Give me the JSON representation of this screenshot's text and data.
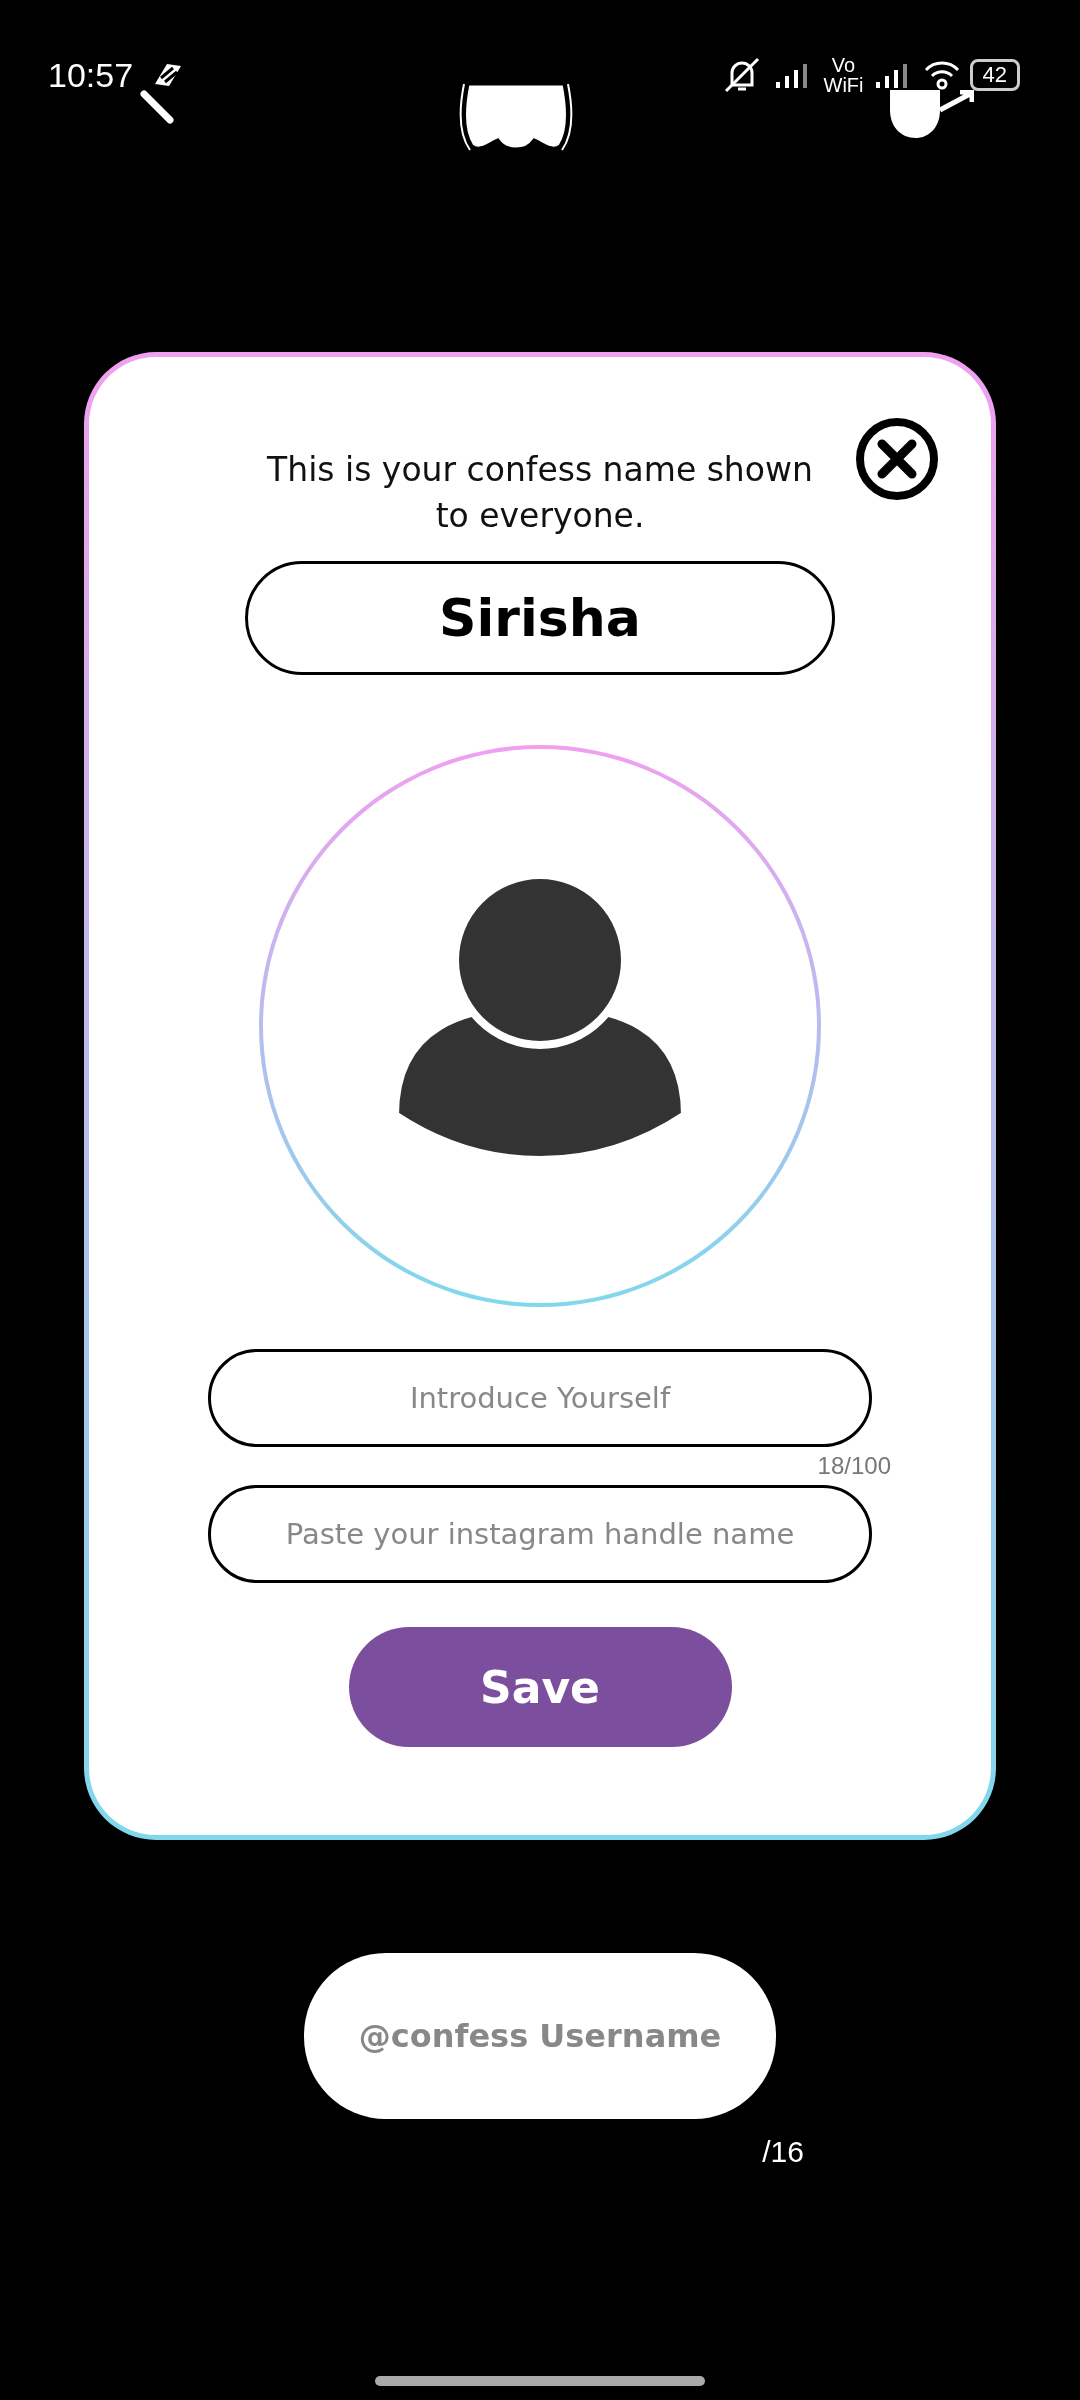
{
  "status_bar": {
    "time": "10:57",
    "network_label_top": "Vo",
    "network_label_bottom": "WiFi",
    "battery": "42"
  },
  "dialog": {
    "message": "This is your confess name shown to everyone.",
    "name_field": {
      "value": "Sirisha"
    },
    "intro_field": {
      "placeholder": "Introduce Yourself",
      "counter": "18/100"
    },
    "instagram_field": {
      "placeholder": "Paste your instagram handle name"
    },
    "save_button": "Save"
  },
  "username_field": {
    "placeholder": "@confess Username",
    "counter": "/16"
  }
}
